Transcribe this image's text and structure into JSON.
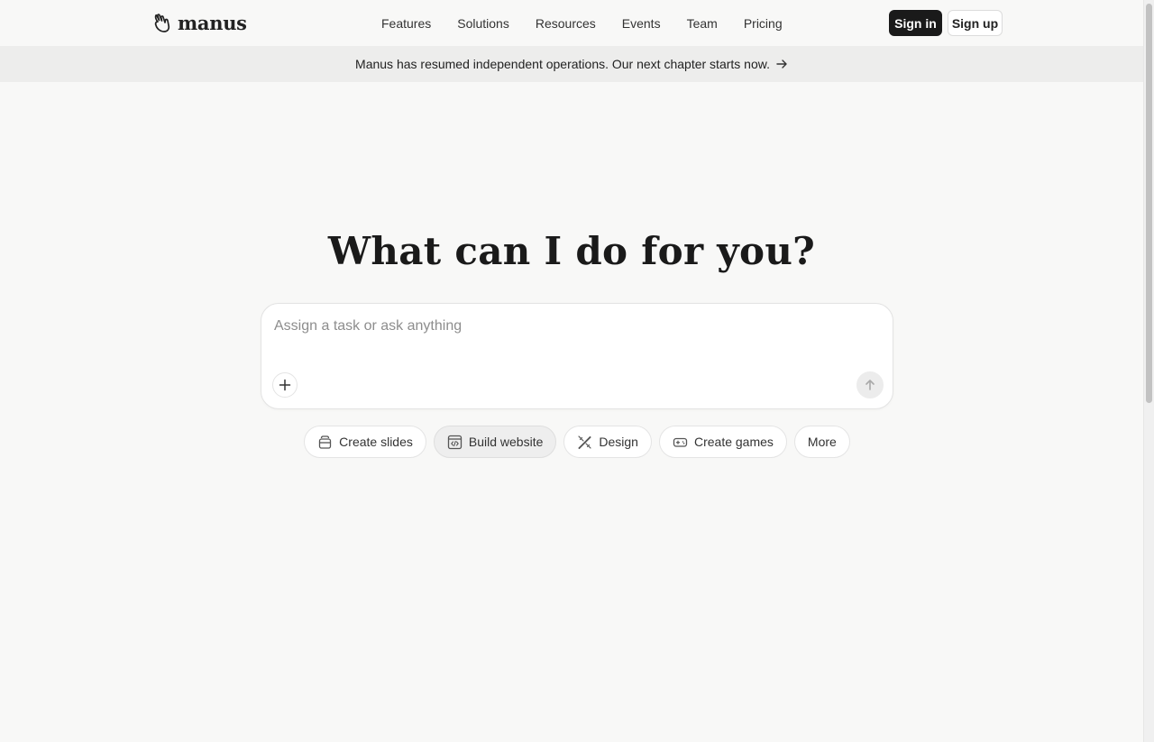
{
  "header": {
    "brand": "manus",
    "nav": [
      "Features",
      "Solutions",
      "Resources",
      "Events",
      "Team",
      "Pricing"
    ],
    "sign_in": "Sign in",
    "sign_up": "Sign up"
  },
  "banner": {
    "text": "Manus has resumed independent operations. Our next chapter starts now.",
    "icon": "arrow-right-icon"
  },
  "hero": {
    "title": "What can I do for you?"
  },
  "composer": {
    "placeholder": "Assign a task or ask anything",
    "value": "",
    "attach_icon": "plus-icon",
    "send_icon": "arrow-up-icon"
  },
  "chips": [
    {
      "label": "Create slides",
      "icon": "slides-icon",
      "active": false
    },
    {
      "label": "Build website",
      "icon": "code-window-icon",
      "active": true
    },
    {
      "label": "Design",
      "icon": "pen-ruler-icon",
      "active": false
    },
    {
      "label": "Create games",
      "icon": "gamepad-icon",
      "active": false
    },
    {
      "label": "More",
      "icon": "",
      "active": false
    }
  ],
  "colors": {
    "background": "#f8f8f7",
    "banner": "#ededec",
    "primary_button": "#1a1a1a",
    "text": "#1a1a1a"
  }
}
